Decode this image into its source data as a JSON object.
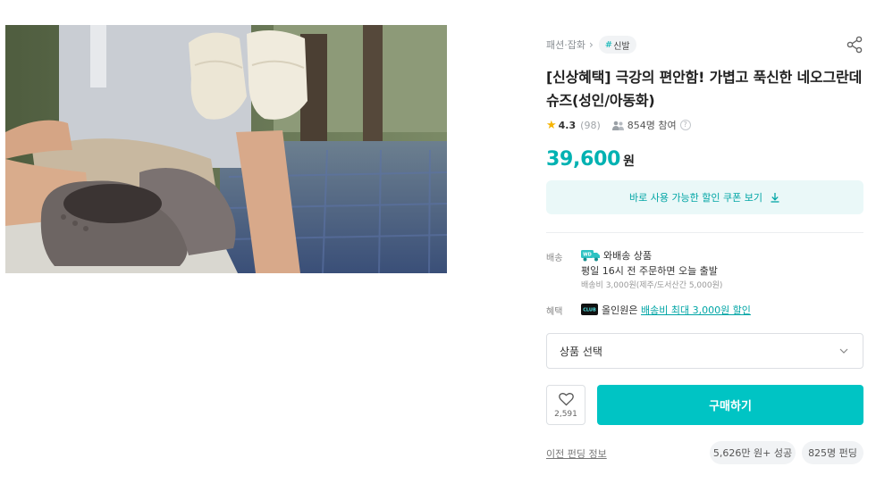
{
  "product_image": {
    "alt": "product-photo"
  },
  "breadcrumb": {
    "category": "패션·잡화",
    "tag_hash": "#",
    "tag": "신발"
  },
  "product": {
    "title": "[신상혜택] 극강의 편안함! 가볍고 푹신한 네오그란데 슈즈(성인/아동화)",
    "rating": "4.3",
    "review_count": "(98)",
    "participants": "854명 참여",
    "help_mark": "?",
    "price": "39,600",
    "currency": "원"
  },
  "coupon": {
    "label": "바로 사용 가능한 할인 쿠폰 보기"
  },
  "shipping": {
    "label": "배송",
    "type": "와배송 상품",
    "schedule": "평일 16시 전 주문하면 오늘 출발",
    "fee": "배송비 3,000원(제주/도서산간 5,000원)",
    "icon_text": "WD"
  },
  "benefit": {
    "label": "혜택",
    "icon_text": "CLUB",
    "prefix": "올인원은 ",
    "link": "배송비 최대 3,000원 할인"
  },
  "option_select": {
    "placeholder": "상품 선택"
  },
  "actions": {
    "like_count": "2,591",
    "buy_label": "구매하기"
  },
  "footer": {
    "previous_funding": "이전 펀딩 정보",
    "funding_amount": "5,626만 원+ 성공",
    "funding_people": "825명 펀딩"
  },
  "colors": {
    "accent": "#00c4c4",
    "price": "#00b2b2",
    "star": "#f6b400"
  }
}
